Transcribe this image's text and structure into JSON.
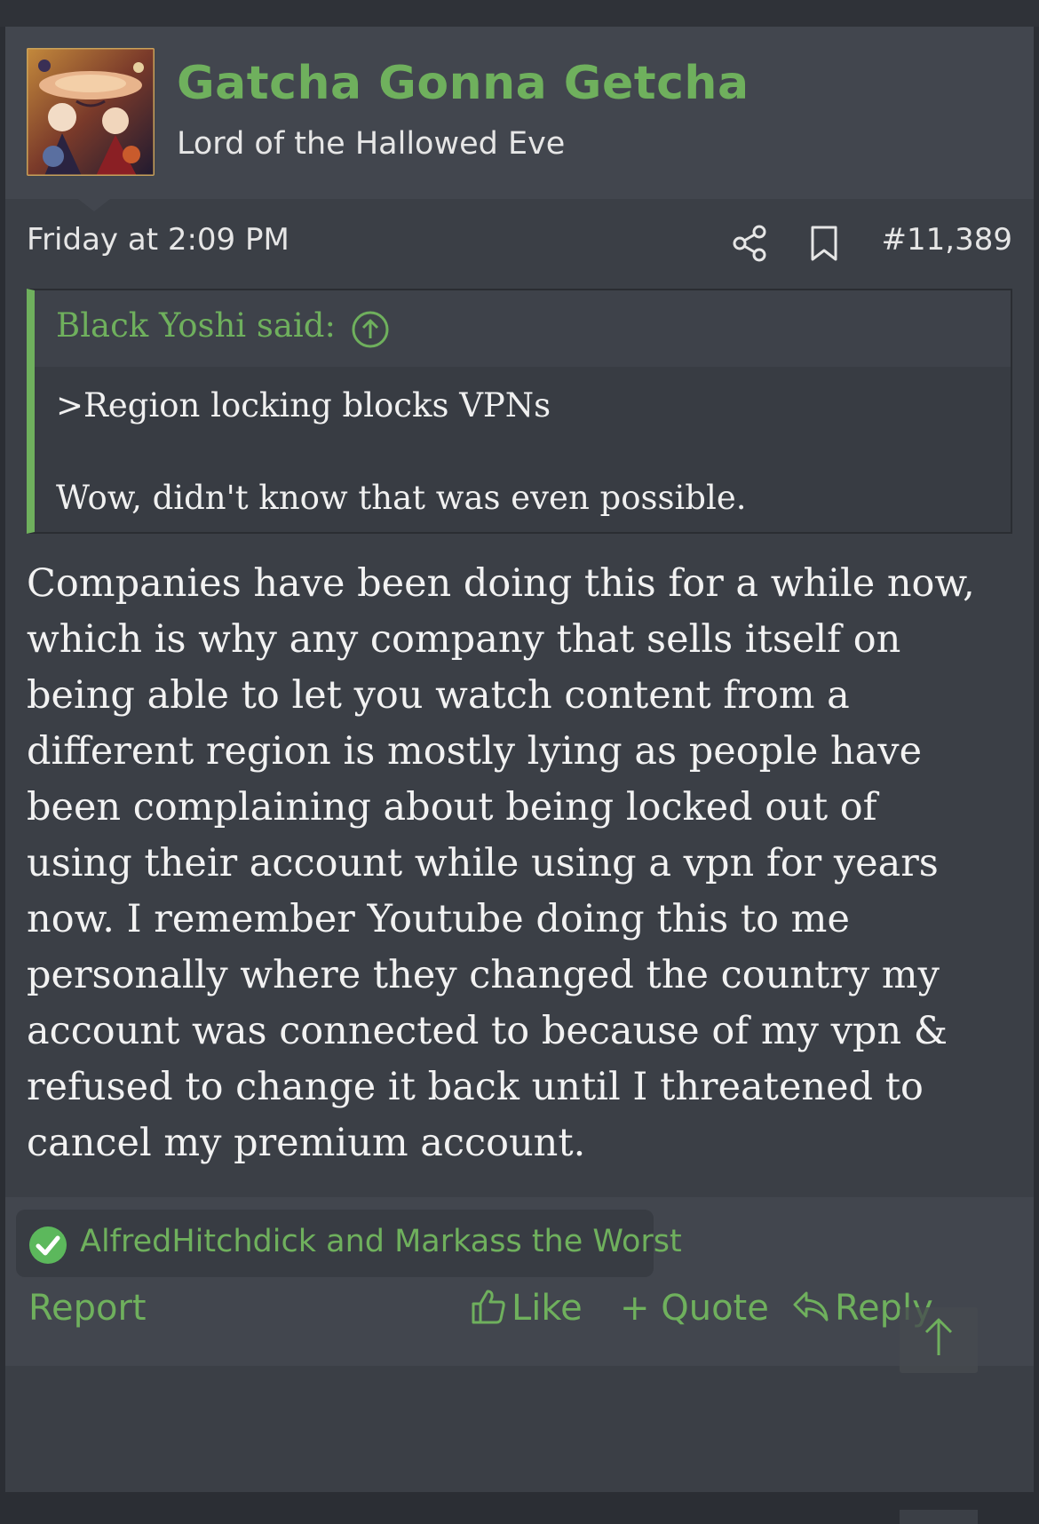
{
  "post": {
    "username": "Gatcha Gonna Getcha",
    "user_title": "Lord of the Hallowed Eve",
    "date": "Friday at 2:09 PM",
    "post_number": "#11,389",
    "quote": {
      "attribution": "Black Yoshi said:",
      "lines": [
        ">Region locking blocks VPNs",
        "Wow, didn't know that was even possible."
      ]
    },
    "body_lines": [
      "Companies have been doing this for a while now,",
      "which is why any company that sells itself on",
      "being able to let you watch content from a",
      "different region is mostly lying as people have",
      "been complaining about being locked out of",
      "using their account while using a vpn for years",
      "now. I remember Youtube doing this to me",
      "personally where they changed the country my",
      "account was connected to because of my vpn &",
      "refused to change it back until I threatened to",
      "cancel my premium account."
    ],
    "reactions_text": "AlfredHitchdick and Markass the Worst",
    "actions": {
      "report": "Report",
      "like": "Like",
      "quote": "+ Quote",
      "reply": "Reply"
    }
  },
  "colors": {
    "accent": "#6fb05d",
    "background": "#3b3f46",
    "header": "#42464e"
  },
  "icons": [
    "share-icon",
    "bookmark-icon",
    "arrow-up-circle-icon",
    "check-circle-icon",
    "thumbs-up-icon",
    "reply-arrow-icon",
    "scroll-top-arrow-icon"
  ]
}
